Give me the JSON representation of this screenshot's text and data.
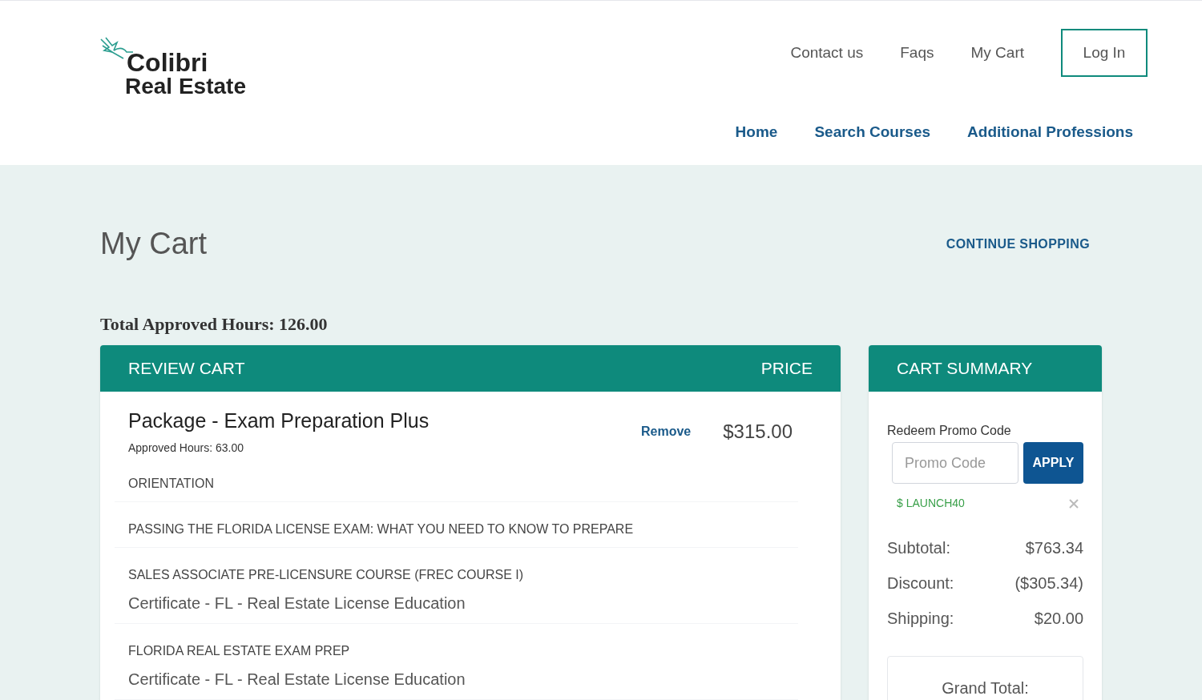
{
  "logo": {
    "line1": "Colibri",
    "line2": "Real Estate"
  },
  "top_links": [
    "Contact us",
    "Faqs",
    "My Cart"
  ],
  "login_button": "Log In",
  "main_nav": [
    "Home",
    "Search Courses",
    "Additional Professions"
  ],
  "page_title": "My Cart",
  "continue_shopping": "CONTINUE SHOPPING",
  "total_hours": {
    "label": "Total Approved Hours:",
    "value": "126.00"
  },
  "review_cart": {
    "header": "REVIEW CART",
    "price_header": "PRICE",
    "item": {
      "title": "Package - Exam Preparation Plus",
      "hours": "Approved Hours: 63.00",
      "remove": "Remove",
      "price": "$315.00",
      "courses": [
        {
          "name": "ORIENTATION"
        },
        {
          "name": "PASSING THE FLORIDA LICENSE EXAM: WHAT YOU NEED TO KNOW TO PREPARE"
        },
        {
          "name": "SALES ASSOCIATE PRE-LICENSURE COURSE (FREC COURSE I)",
          "certificate": "Certificate - FL - Real Estate License Education"
        },
        {
          "name": "FLORIDA REAL ESTATE EXAM PREP",
          "certificate": "Certificate - FL - Real Estate License Education"
        }
      ]
    }
  },
  "cart_summary": {
    "header": "CART SUMMARY",
    "promo_label": "Redeem Promo Code",
    "promo_placeholder": "Promo Code",
    "apply": "APPLY",
    "applied_code": "$ LAUNCH40",
    "lines": [
      {
        "label": "Subtotal:",
        "value": "$763.34"
      },
      {
        "label": "Discount:",
        "value": "($305.34)"
      },
      {
        "label": "Shipping:",
        "value": "$20.00"
      }
    ],
    "grand_total_label": "Grand Total:"
  }
}
